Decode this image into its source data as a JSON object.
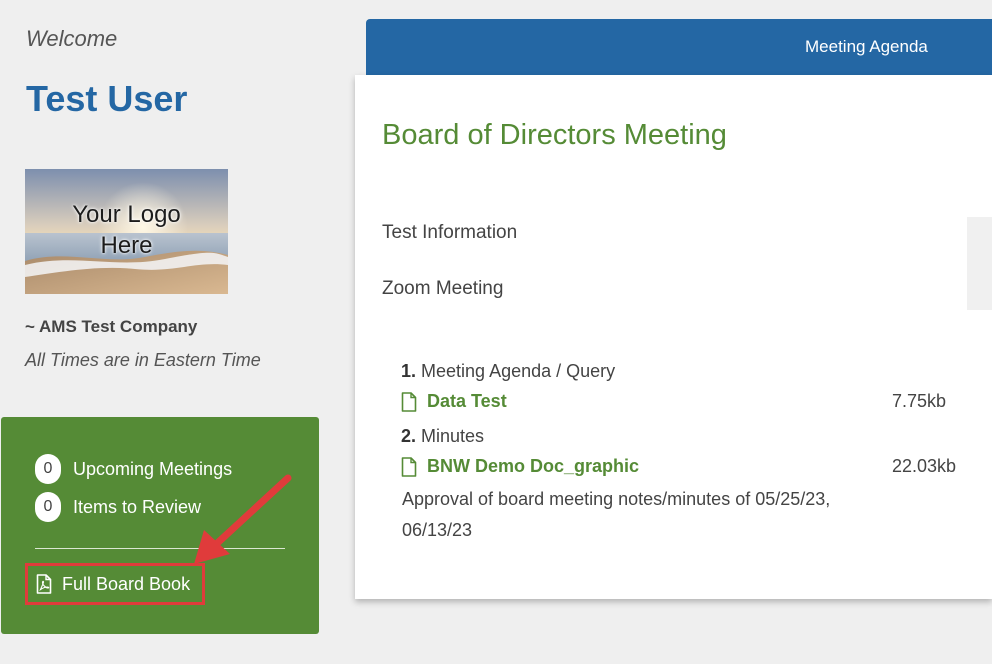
{
  "sidebar": {
    "welcome_text": "Welcome",
    "user_name": "Test User",
    "logo_text_line1": "Your Logo",
    "logo_text_line2": "Here",
    "company": "~ AMS Test Company",
    "timezone_note": "All Times are in Eastern Time",
    "stats": [
      {
        "count": "0",
        "label": "Upcoming Meetings"
      },
      {
        "count": "0",
        "label": "Items to Review"
      }
    ],
    "board_book_label": "Full Board Book"
  },
  "main": {
    "tab_label": "Meeting Agenda",
    "meeting_title": "Board of Directors Meeting",
    "info_lines": [
      "Test Information",
      "Zoom Meeting"
    ],
    "agenda": [
      {
        "number": "1.",
        "title": "Meeting Agenda / Query",
        "document": "Data Test",
        "size": "7.75kb"
      },
      {
        "number": "2.",
        "title": "Minutes",
        "document": "BNW Demo Doc_graphic",
        "size": "22.03kb",
        "note": "Approval of board meeting notes/minutes of 05/25/23, 06/13/23"
      }
    ]
  },
  "colors": {
    "brand_blue": "#2467a4",
    "brand_green": "#558b36",
    "annotation_red": "#e03b3b"
  },
  "icons": [
    "file-pdf-icon",
    "document-icon",
    "annotation-arrow"
  ]
}
